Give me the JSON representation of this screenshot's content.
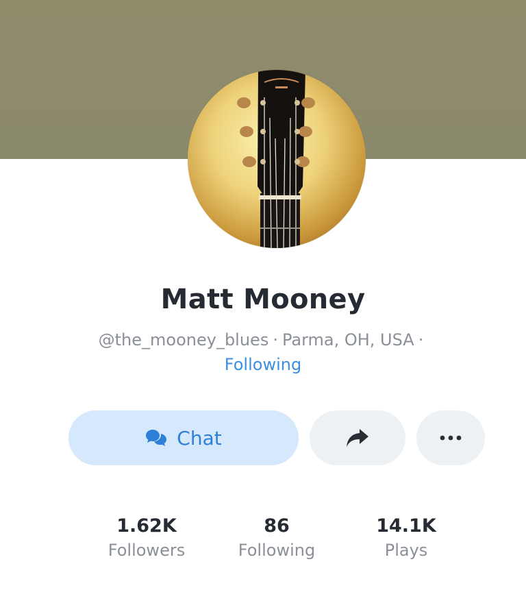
{
  "profile": {
    "name": "Matt Mooney",
    "handle": "@the_mooney_blues",
    "location": "Parma, OH, USA",
    "separator": "·",
    "follow_status": "Following"
  },
  "actions": {
    "chat_label": "Chat"
  },
  "stats": [
    {
      "value": "1.62K",
      "label": "Followers"
    },
    {
      "value": "86",
      "label": "Following"
    },
    {
      "value": "14.1K",
      "label": "Plays"
    }
  ],
  "colors": {
    "accent": "#3b8fe0",
    "chat_bg": "#d6e8fb",
    "cover": "#8d8b6c",
    "button_bg": "#eef1f4",
    "text_primary": "#262a33",
    "text_secondary": "#8a8f98"
  },
  "icons": {
    "chat": "chat-bubbles-icon",
    "share": "share-arrow-icon",
    "more": "more-dots-icon"
  }
}
